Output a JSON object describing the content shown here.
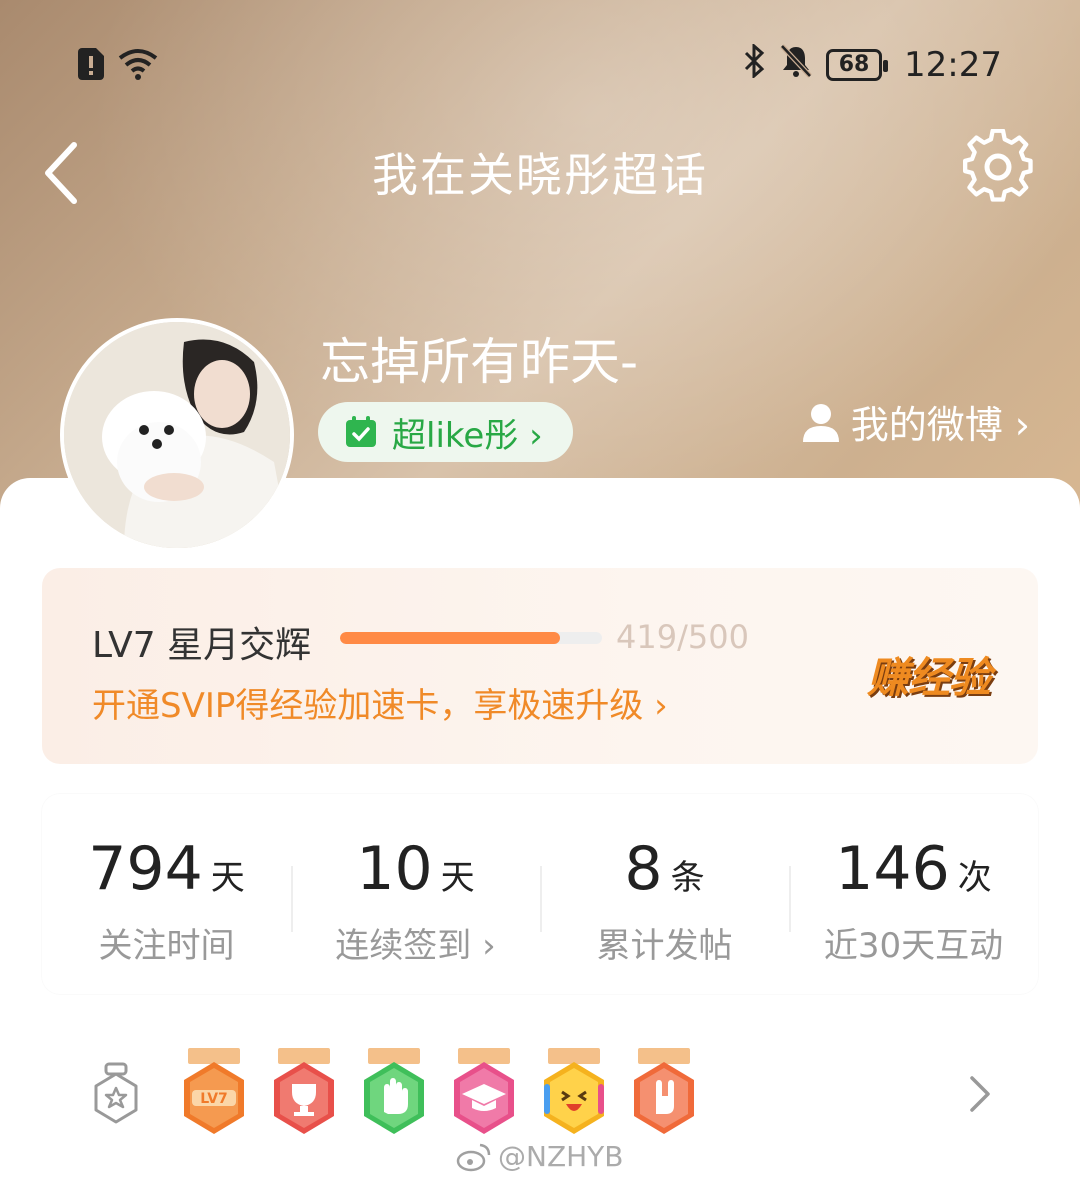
{
  "status_bar": {
    "time": "12:27",
    "battery": "68",
    "icons": [
      "sim-alert-icon",
      "wifi-icon",
      "bluetooth-icon",
      "mute-icon",
      "battery-icon"
    ]
  },
  "nav": {
    "title": "我在关晓彤超话",
    "back_icon": "chevron-left-icon",
    "settings_icon": "gear-icon"
  },
  "profile": {
    "username": "忘掉所有昨天-",
    "badge_label": "超like彤 ›",
    "my_weibo_label": "我的微博 ›"
  },
  "level": {
    "title": "LV7 星月交辉",
    "progress_text": "419/500",
    "progress_fraction": 0.838,
    "svip_link": "开通SVIP得经验加速卡，享极速升级 ›",
    "earn_label": "赚经验"
  },
  "stats": [
    {
      "num": "794",
      "unit": "天",
      "label": "关注时间"
    },
    {
      "num": "10",
      "unit": "天",
      "label": "连续签到 ›"
    },
    {
      "num": "8",
      "unit": "条",
      "label": "累计发帖"
    },
    {
      "num": "146",
      "unit": "次",
      "label": "近30天互动"
    }
  ],
  "badges": {
    "items": [
      {
        "name": "lv7-badge",
        "color": "#f07a2a",
        "text": "LV7"
      },
      {
        "name": "trophy-badge",
        "color": "#e8504a"
      },
      {
        "name": "hand-badge",
        "color": "#3fbf5a"
      },
      {
        "name": "graduation-badge",
        "color": "#e8508a"
      },
      {
        "name": "emoji-badge",
        "color": "#f5b21e"
      },
      {
        "name": "rock-hand-badge",
        "color": "#f06a3a"
      }
    ]
  },
  "watermark": "@NZHYB",
  "colors": {
    "accent_orange": "#ff8a45",
    "green": "#28a845"
  }
}
